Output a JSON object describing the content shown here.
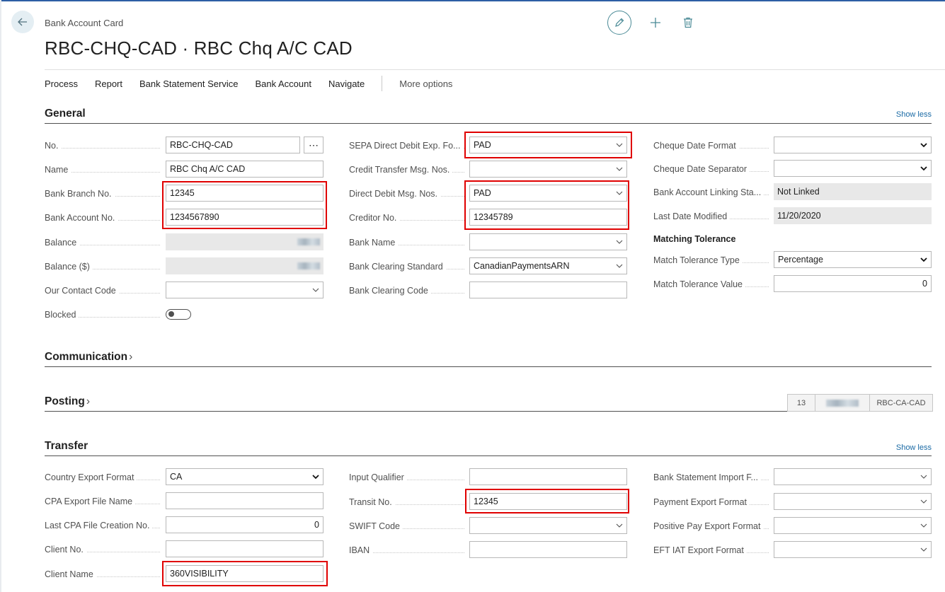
{
  "header": {
    "caption": "Bank Account Card",
    "title": "RBC-CHQ-CAD · RBC Chq A/C CAD"
  },
  "actions": {
    "items": [
      "Process",
      "Report",
      "Bank Statement Service",
      "Bank Account",
      "Navigate"
    ],
    "more": "More options"
  },
  "general": {
    "title": "General",
    "show_less": "Show less",
    "no_label": "No.",
    "no_value": "RBC-CHQ-CAD",
    "name_label": "Name",
    "name_value": "RBC Chq A/C CAD",
    "bank_branch_label": "Bank Branch No.",
    "bank_branch_value": "12345",
    "bank_account_label": "Bank Account No.",
    "bank_account_value": "1234567890",
    "balance_label": "Balance",
    "balance_usd_label": "Balance ($)",
    "contact_label": "Our Contact Code",
    "contact_value": "",
    "blocked_label": "Blocked",
    "sepa_label": "SEPA Direct Debit Exp. Fo...",
    "sepa_value": "PAD",
    "credit_transfer_label": "Credit Transfer Msg. Nos.",
    "credit_transfer_value": "",
    "direct_debit_label": "Direct Debit Msg. Nos.",
    "direct_debit_value": "PAD",
    "creditor_label": "Creditor No.",
    "creditor_value": "12345789",
    "bank_name_label": "Bank Name",
    "bank_name_value": "",
    "clearing_std_label": "Bank Clearing Standard",
    "clearing_std_value": "CanadianPaymentsARN",
    "clearing_code_label": "Bank Clearing Code",
    "clearing_code_value": "",
    "cheque_format_label": "Cheque Date Format",
    "cheque_format_value": "",
    "cheque_sep_label": "Cheque Date Separator",
    "cheque_sep_value": "",
    "linking_label": "Bank Account Linking Sta...",
    "linking_value": "Not Linked",
    "last_modified_label": "Last Date Modified",
    "last_modified_value": "11/20/2020",
    "matching_heading": "Matching Tolerance",
    "match_type_label": "Match Tolerance Type",
    "match_type_value": "Percentage",
    "match_value_label": "Match Tolerance Value",
    "match_value_value": "0"
  },
  "communication": {
    "title": "Communication"
  },
  "posting": {
    "title": "Posting",
    "cue_1": "13",
    "cue_3": "RBC-CA-CAD"
  },
  "transfer": {
    "title": "Transfer",
    "show_less": "Show less",
    "country_label": "Country Export Format",
    "country_value": "CA",
    "cpa_file_label": "CPA Export File Name",
    "cpa_file_value": "",
    "last_cpa_label": "Last CPA File Creation No.",
    "last_cpa_value": "0",
    "client_no_label": "Client No.",
    "client_no_value": "",
    "client_name_label": "Client Name",
    "client_name_value": "360VISIBILITY",
    "input_qual_label": "Input Qualifier",
    "input_qual_value": "",
    "transit_label": "Transit No.",
    "transit_value": "12345",
    "swift_label": "SWIFT Code",
    "swift_value": "",
    "iban_label": "IBAN",
    "iban_value": "",
    "stmt_import_label": "Bank Statement Import F...",
    "stmt_import_value": "",
    "payment_export_label": "Payment Export Format",
    "payment_export_value": "",
    "positive_pay_label": "Positive Pay Export Format",
    "positive_pay_value": "",
    "eft_label": "EFT IAT Export Format",
    "eft_value": ""
  },
  "colors": {
    "accent": "#1a6aa5",
    "highlight": "#e00000",
    "teal": "#4a8a96"
  }
}
